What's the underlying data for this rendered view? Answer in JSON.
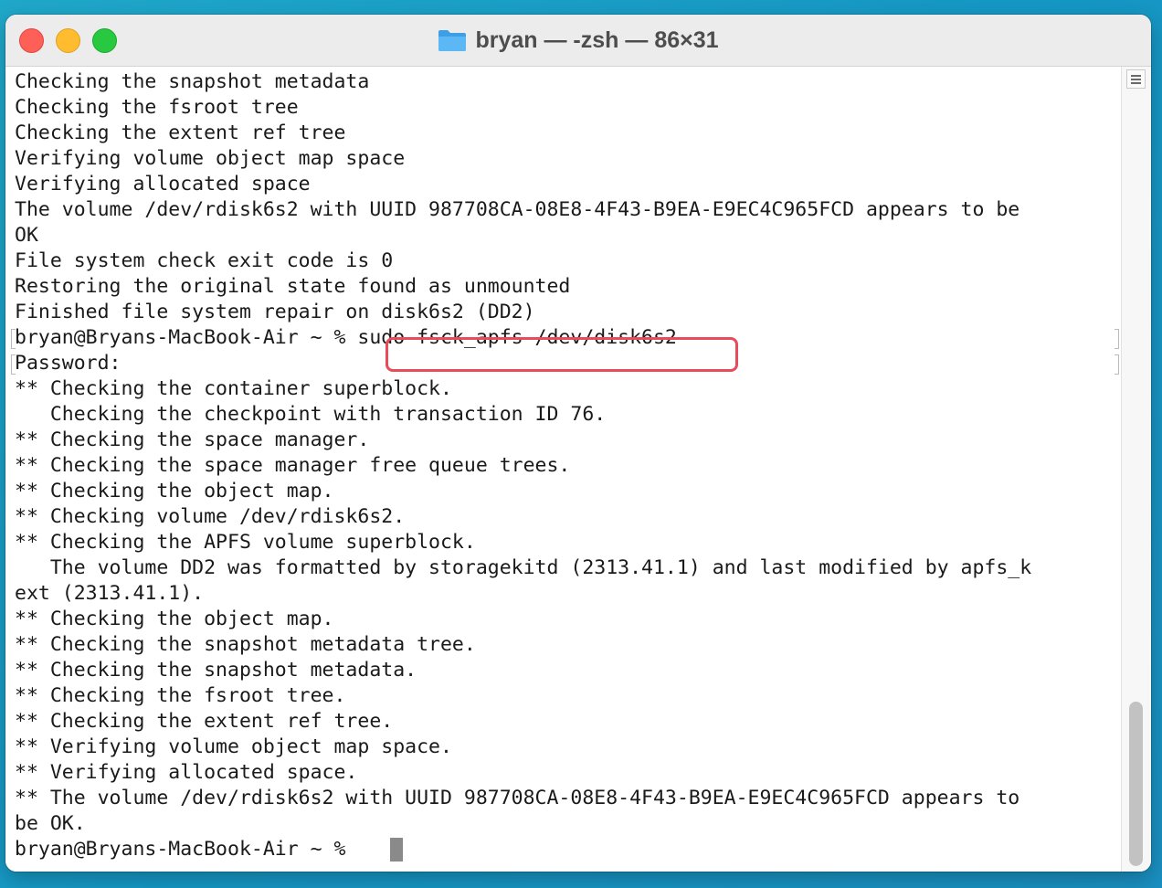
{
  "window": {
    "title": "bryan — -zsh — 86×31"
  },
  "terminal": {
    "lines": [
      "Checking the snapshot metadata",
      "Checking the fsroot tree",
      "Checking the extent ref tree",
      "Verifying volume object map space",
      "Verifying allocated space",
      "The volume /dev/rdisk6s2 with UUID 987708CA-08E8-4F43-B9EA-E9EC4C965FCD appears to be",
      "OK",
      "File system check exit code is 0",
      "Restoring the original state found as unmounted",
      "Finished file system repair on disk6s2 (DD2)",
      "bryan@Bryans-MacBook-Air ~ % sudo fsck_apfs /dev/disk6s2",
      "Password:",
      "** Checking the container superblock.",
      "   Checking the checkpoint with transaction ID 76.",
      "** Checking the space manager.",
      "** Checking the space manager free queue trees.",
      "** Checking the object map.",
      "** Checking volume /dev/rdisk6s2.",
      "** Checking the APFS volume superblock.",
      "   The volume DD2 was formatted by storagekitd (2313.41.1) and last modified by apfs_k",
      "ext (2313.41.1).",
      "** Checking the object map.",
      "** Checking the snapshot metadata tree.",
      "** Checking the snapshot metadata.",
      "** Checking the fsroot tree.",
      "** Checking the extent ref tree.",
      "** Verifying volume object map space.",
      "** Verifying allocated space.",
      "** The volume /dev/rdisk6s2 with UUID 987708CA-08E8-4F43-B9EA-E9EC4C965FCD appears to",
      "be OK.",
      "bryan@Bryans-MacBook-Air ~ % "
    ],
    "highlighted_command": "sudo fsck_apfs /dev/disk6s2"
  },
  "colors": {
    "highlight": "#e94b5a",
    "text": "#1a1a1a"
  }
}
